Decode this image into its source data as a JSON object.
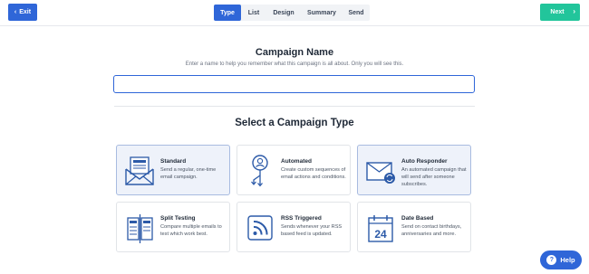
{
  "header": {
    "exit_label": "Exit",
    "next_label": "Next",
    "steps": [
      "Type",
      "List",
      "Design",
      "Summary",
      "Send"
    ],
    "active_step": "Type"
  },
  "campaign_name": {
    "title": "Campaign Name",
    "subtitle": "Enter a name to help you remember what this campaign is all about. Only you will see this.",
    "value": ""
  },
  "campaign_type": {
    "title": "Select a Campaign Type",
    "cards": [
      {
        "title": "Standard",
        "desc": "Send a regular, one-time email campaign.",
        "icon": "envelope-newsletter-icon"
      },
      {
        "title": "Automated",
        "desc": "Create custom sequences of email actions and conditions.",
        "icon": "automation-flow-icon"
      },
      {
        "title": "Auto Responder",
        "desc": "An automated campaign that will send after someone subscribes.",
        "icon": "envelope-sync-icon"
      },
      {
        "title": "Split Testing",
        "desc": "Compare multiple emails to test which work best.",
        "icon": "split-test-icon"
      },
      {
        "title": "RSS Triggered",
        "desc": "Sends whenever your RSS based feed is updated.",
        "icon": "rss-icon"
      },
      {
        "title": "Date Based",
        "desc": "Send on contact birthdays, anniversaries and more.",
        "icon": "calendar-icon"
      }
    ],
    "calendar_day": "24"
  },
  "help_label": "Help",
  "colors": {
    "primary": "#2f66d8",
    "next": "#22c59b",
    "icon": "#2c5aa8"
  }
}
